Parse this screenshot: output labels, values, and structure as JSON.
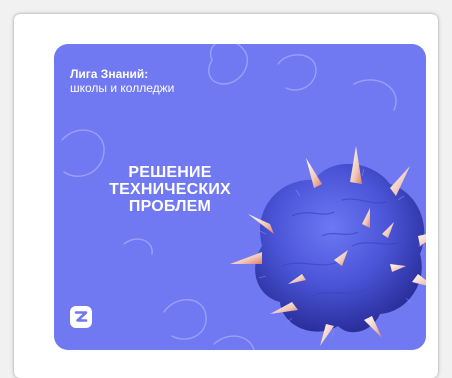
{
  "banner": {
    "brand_name": "Лига Знаний:",
    "brand_sub": "школы и колледжи",
    "headline": [
      "РЕШЕНИЕ",
      "ТЕХНИЧЕСКИХ",
      "ПРОБЛЕМ"
    ],
    "logo_icon": "z-logo-icon",
    "illustration": "spiky-brain-icon"
  },
  "colors": {
    "banner_bg": "#7079f2",
    "brain_main": "#4a54d6",
    "text": "#ffffff"
  }
}
